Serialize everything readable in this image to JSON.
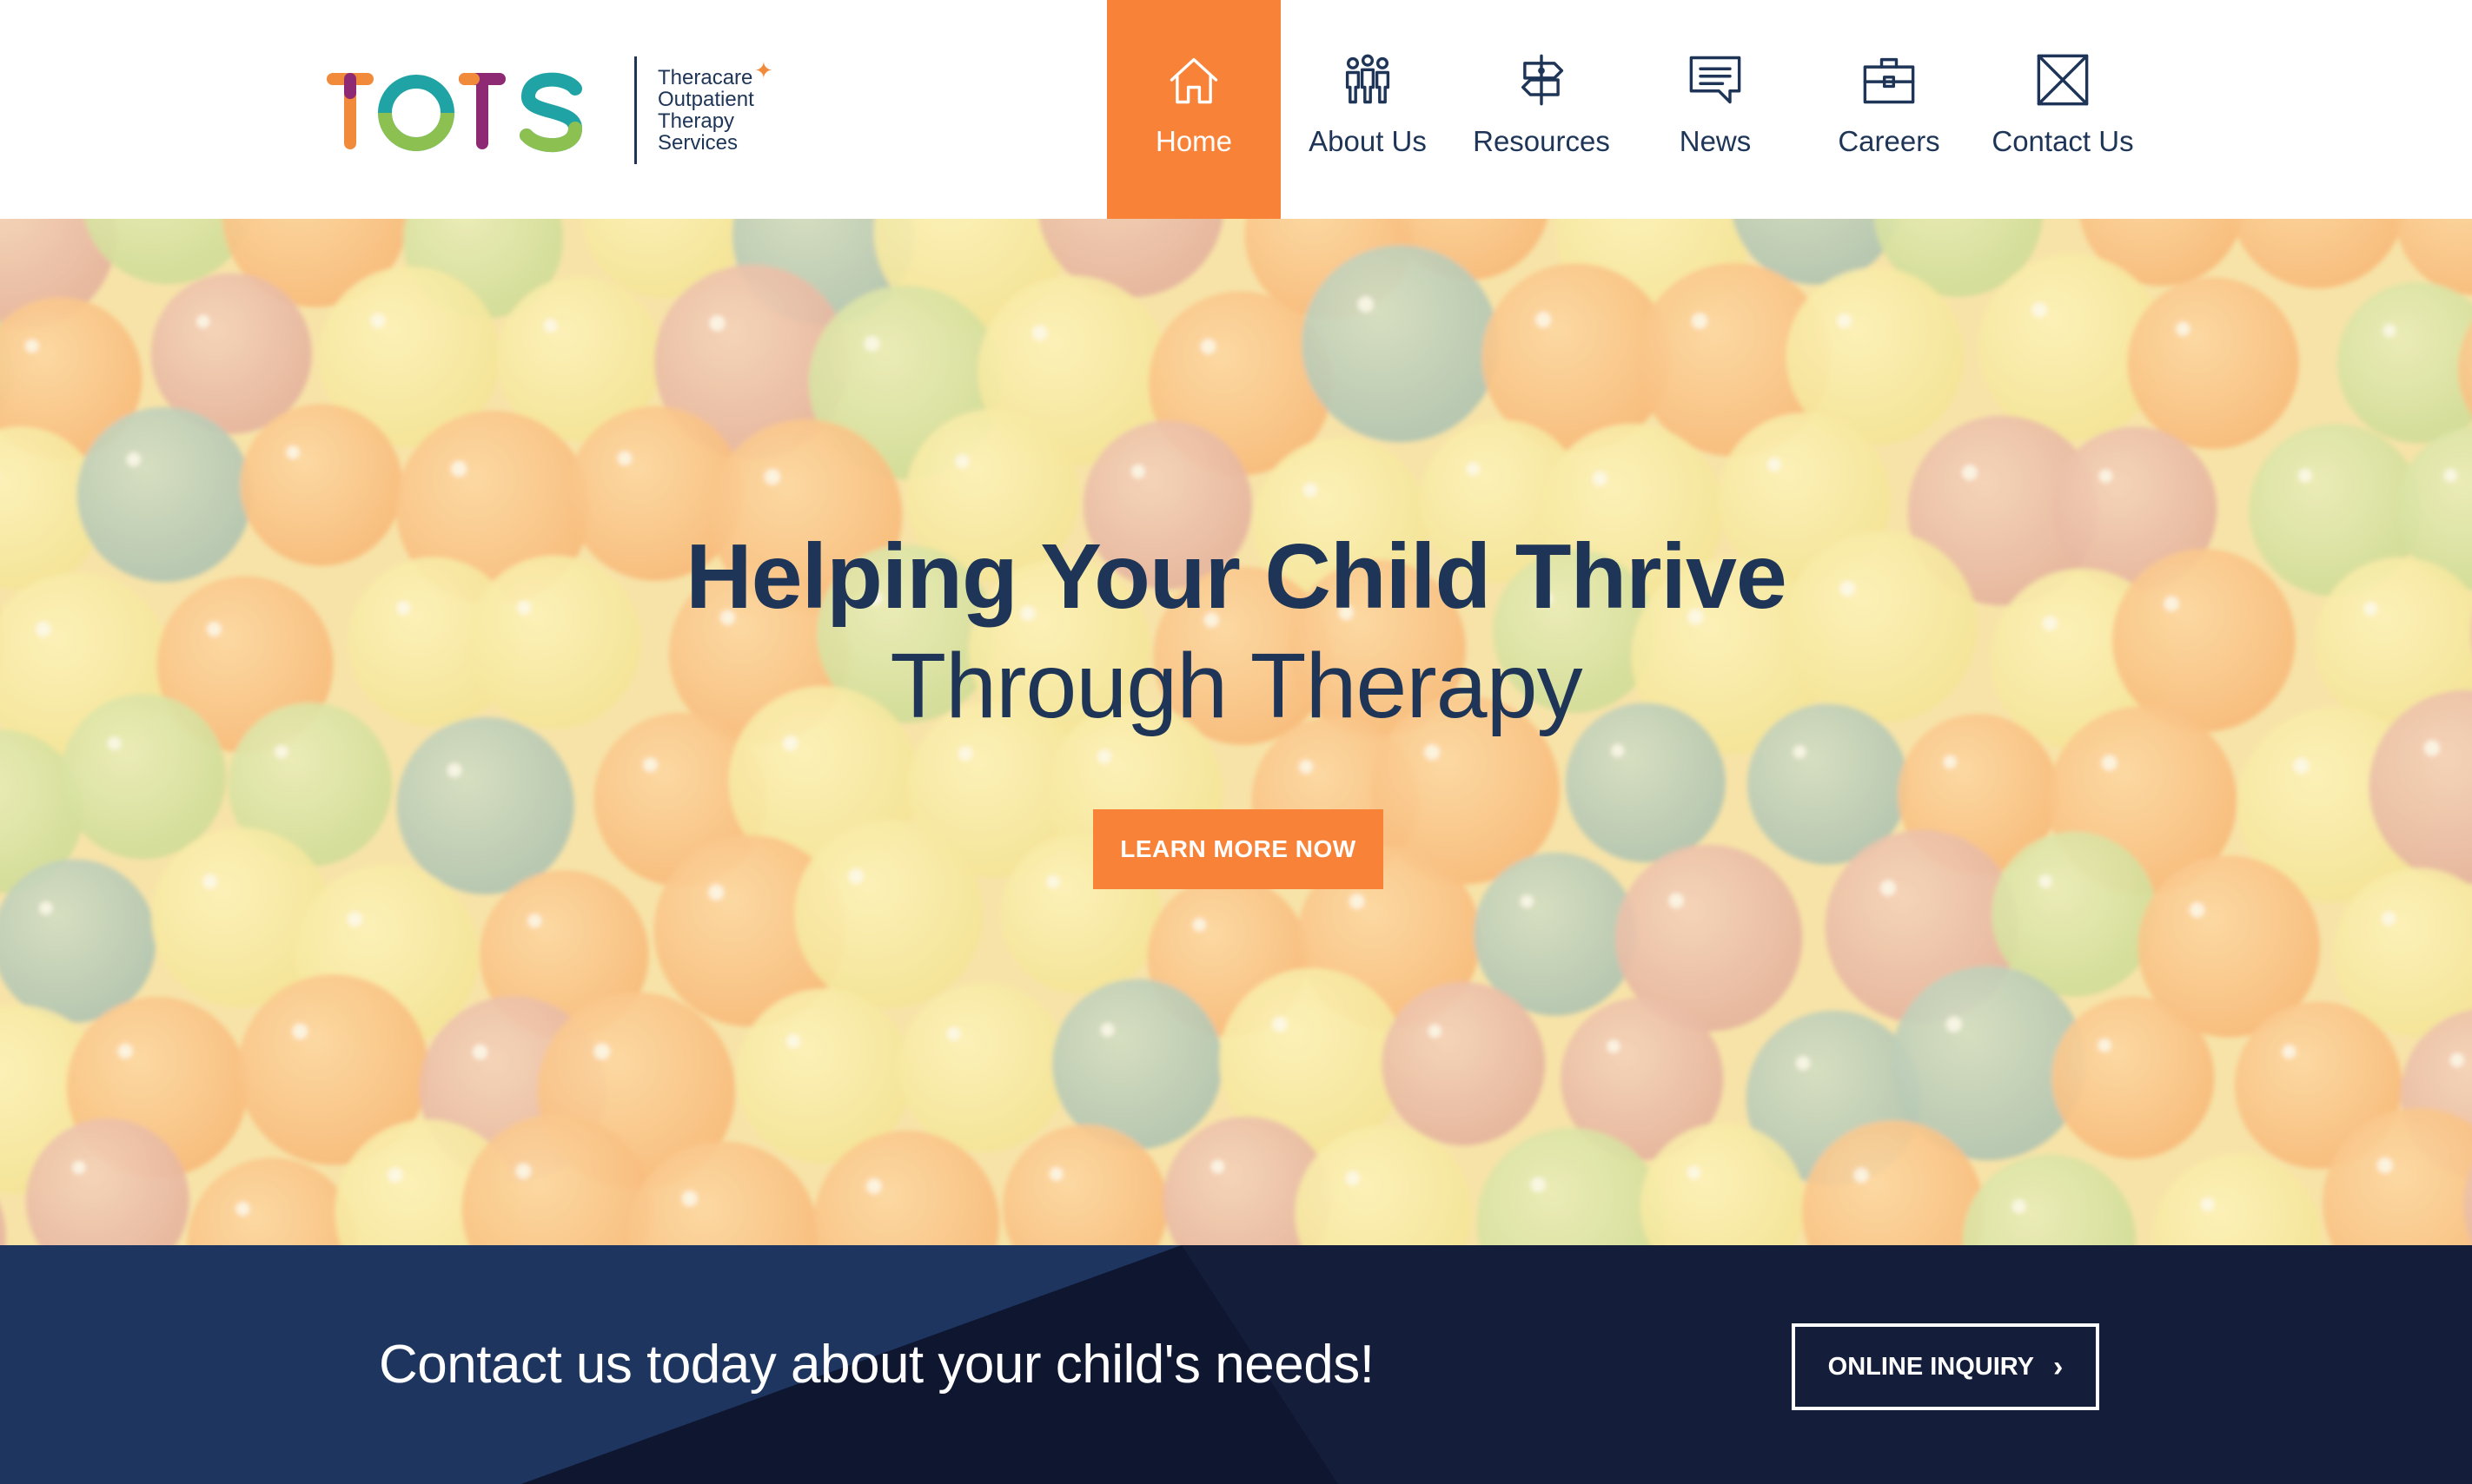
{
  "brand": {
    "logo_text": "TOTS",
    "tagline": [
      "Theracare",
      "Outpatient",
      "Therapy",
      "Services"
    ],
    "letter_colors": {
      "t1": "#f18a3b",
      "t1_top": "#8d2a73",
      "o": "#1fa3a4",
      "o_bottom": "#8cc152",
      "t2": "#8d2a73",
      "t2_top": "#f18a3b",
      "s": "#1fa3a4",
      "s_bottom": "#8cc152"
    }
  },
  "nav": {
    "items": [
      {
        "label": "Home",
        "icon": "home-icon",
        "active": true
      },
      {
        "label": "About Us",
        "icon": "people-icon",
        "active": false
      },
      {
        "label": "Resources",
        "icon": "signpost-icon",
        "active": false
      },
      {
        "label": "News",
        "icon": "speech-bubble-icon",
        "active": false
      },
      {
        "label": "Careers",
        "icon": "briefcase-icon",
        "active": false
      },
      {
        "label": "Contact Us",
        "icon": "envelope-icon",
        "active": false
      }
    ]
  },
  "hero": {
    "title": "Helping Your Child Thrive",
    "subtitle": "Through Therapy",
    "button_label": "LEARN MORE NOW",
    "background": "colorful-water-beads"
  },
  "contact_band": {
    "text": "Contact us today about your child's needs!",
    "button_label": "ONLINE INQUIRY",
    "button_icon": "chevron-right-icon"
  },
  "colors": {
    "accent": "#f98239",
    "navy": "#1e3557",
    "band_dark": "#141d3a",
    "band_light": "#1e3560"
  }
}
